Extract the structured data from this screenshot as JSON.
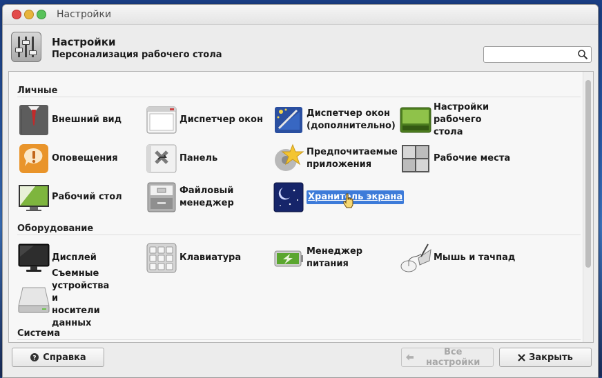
{
  "window": {
    "title": "Настройки"
  },
  "header": {
    "title": "Настройки",
    "subtitle": "Персонализация рабочего стола",
    "search": {
      "value": "",
      "placeholder": ""
    }
  },
  "categories": [
    {
      "label": "Личные",
      "items": [
        {
          "label": "Внешний вид",
          "icon": "appearance-icon"
        },
        {
          "label": "Диспетчер окон",
          "icon": "window-manager-icon"
        },
        {
          "label": "Диспетчер окон\n(дополнительно)",
          "icon": "window-manager-tweaks-icon"
        },
        {
          "label": "Настройки\nрабочего стола",
          "icon": "desktop-settings-icon"
        },
        {
          "label": "Оповещения",
          "icon": "notifications-icon"
        },
        {
          "label": "Панель",
          "icon": "panel-icon"
        },
        {
          "label": "Предпочитаемые\nприложения",
          "icon": "preferred-apps-icon"
        },
        {
          "label": "Рабочие места",
          "icon": "workspaces-icon"
        },
        {
          "label": "Рабочий стол",
          "icon": "desktop-icon"
        },
        {
          "label": "Файловый\nменеджер",
          "icon": "file-manager-icon"
        },
        {
          "label": "Хранитель экрана",
          "icon": "screensaver-icon",
          "selected": true
        }
      ]
    },
    {
      "label": "Оборудование",
      "items": [
        {
          "label": "Дисплей",
          "icon": "display-icon"
        },
        {
          "label": "Клавиатура",
          "icon": "keyboard-icon"
        },
        {
          "label": "Менеджер\nпитания",
          "icon": "power-manager-icon"
        },
        {
          "label": "Мышь и тачпад",
          "icon": "mouse-touchpad-icon"
        },
        {
          "label": "Съемные\nустройства и\nносители данных",
          "icon": "removable-drives-icon"
        }
      ]
    },
    {
      "label": "Система",
      "items": []
    }
  ],
  "buttons": {
    "help": "Справка",
    "all_settings": "Все настройки",
    "close": "Закрыть"
  },
  "colors": {
    "selection": "#3d7bd9",
    "window_bg": "#ececec"
  }
}
